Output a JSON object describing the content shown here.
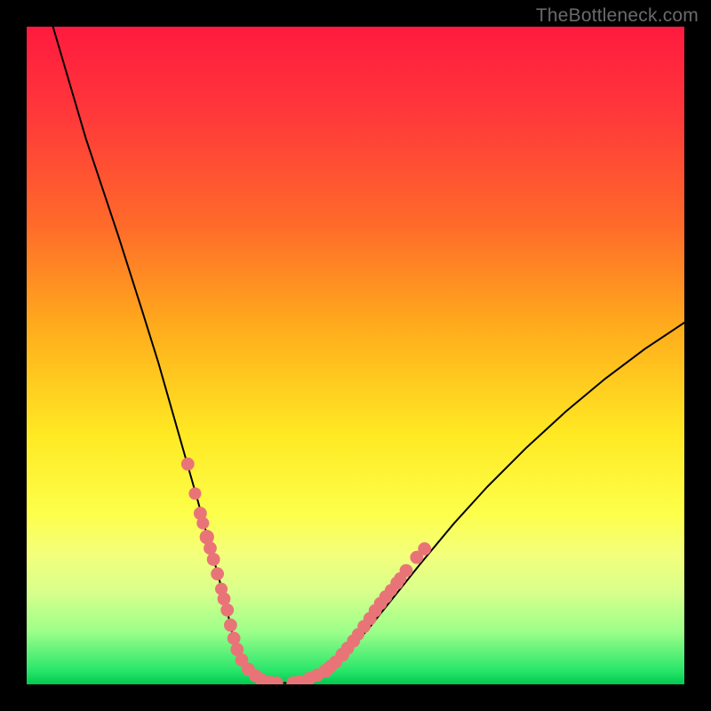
{
  "watermark": {
    "text": "TheBottleneck.com"
  },
  "chart_data": {
    "type": "line",
    "title": "",
    "xlabel": "",
    "ylabel": "",
    "xlim": [
      0,
      100
    ],
    "ylim": [
      0,
      100
    ],
    "series": [
      {
        "name": "curve",
        "x": [
          4,
          9,
          14,
          17.5,
          20,
          22,
          24,
          26,
          27.6,
          29,
          30.2,
          31.2,
          32.4,
          33.4,
          34.6,
          36,
          38,
          40,
          42,
          45,
          48,
          52,
          56,
          60,
          65,
          70,
          76,
          82,
          88,
          94,
          100
        ],
        "y": [
          100,
          83,
          68,
          57,
          49,
          42,
          35,
          28,
          22,
          17,
          12.5,
          8,
          4.5,
          2.5,
          1.2,
          0.5,
          0.2,
          0.2,
          0.5,
          1.6,
          4,
          8.5,
          13.5,
          18.5,
          24.5,
          30,
          36,
          41.5,
          46.5,
          51,
          55
        ]
      }
    ],
    "markers": [
      {
        "x": 24.5,
        "y": 33.5,
        "r": 1.0
      },
      {
        "x": 25.6,
        "y": 29.0,
        "r": 0.95
      },
      {
        "x": 26.4,
        "y": 26.0,
        "r": 1.0
      },
      {
        "x": 26.8,
        "y": 24.5,
        "r": 0.95
      },
      {
        "x": 27.4,
        "y": 22.4,
        "r": 1.1
      },
      {
        "x": 27.9,
        "y": 20.7,
        "r": 1.0
      },
      {
        "x": 28.4,
        "y": 19.0,
        "r": 1.0
      },
      {
        "x": 29.0,
        "y": 16.8,
        "r": 1.0
      },
      {
        "x": 29.6,
        "y": 14.5,
        "r": 0.95
      },
      {
        "x": 30.0,
        "y": 13.0,
        "r": 1.0
      },
      {
        "x": 30.5,
        "y": 11.3,
        "r": 1.0
      },
      {
        "x": 31.0,
        "y": 9.0,
        "r": 1.0
      },
      {
        "x": 31.5,
        "y": 7.0,
        "r": 1.0
      },
      {
        "x": 32.0,
        "y": 5.3,
        "r": 1.0
      },
      {
        "x": 32.7,
        "y": 3.7,
        "r": 1.0
      },
      {
        "x": 33.7,
        "y": 2.3,
        "r": 1.0
      },
      {
        "x": 34.8,
        "y": 1.3,
        "r": 1.0
      },
      {
        "x": 35.7,
        "y": 0.7,
        "r": 1.0
      },
      {
        "x": 37.0,
        "y": 0.3,
        "r": 1.0
      },
      {
        "x": 38.0,
        "y": 0.2,
        "r": 1.0
      },
      {
        "x": 40.5,
        "y": 0.2,
        "r": 1.0
      },
      {
        "x": 41.5,
        "y": 0.4,
        "r": 1.0
      },
      {
        "x": 43.0,
        "y": 0.9,
        "r": 1.0
      },
      {
        "x": 44.2,
        "y": 1.4,
        "r": 1.0
      },
      {
        "x": 45.5,
        "y": 2.1,
        "r": 1.05
      },
      {
        "x": 46.2,
        "y": 2.7,
        "r": 1.0
      },
      {
        "x": 47.0,
        "y": 3.4,
        "r": 1.0
      },
      {
        "x": 48.0,
        "y": 4.5,
        "r": 1.05
      },
      {
        "x": 48.8,
        "y": 5.5,
        "r": 1.0
      },
      {
        "x": 49.7,
        "y": 6.6,
        "r": 1.0
      },
      {
        "x": 50.4,
        "y": 7.6,
        "r": 0.95
      },
      {
        "x": 51.3,
        "y": 8.8,
        "r": 1.0
      },
      {
        "x": 52.2,
        "y": 10.0,
        "r": 1.0
      },
      {
        "x": 53.0,
        "y": 11.2,
        "r": 1.0
      },
      {
        "x": 53.8,
        "y": 12.3,
        "r": 1.0
      },
      {
        "x": 54.6,
        "y": 13.3,
        "r": 1.0
      },
      {
        "x": 55.4,
        "y": 14.3,
        "r": 0.95
      },
      {
        "x": 56.3,
        "y": 15.4,
        "r": 1.0
      },
      {
        "x": 56.8,
        "y": 16.1,
        "r": 0.95
      },
      {
        "x": 57.7,
        "y": 17.3,
        "r": 1.0
      },
      {
        "x": 59.3,
        "y": 19.3,
        "r": 1.0
      },
      {
        "x": 60.5,
        "y": 20.6,
        "r": 1.0
      }
    ],
    "marker_color": "#e97478",
    "curve_color": "#000000",
    "gradient_colors": {
      "top": "#ff1a3f",
      "mid_upper": "#ffad1c",
      "mid_lower": "#fdff4a",
      "bottom": "#00c94f"
    }
  }
}
